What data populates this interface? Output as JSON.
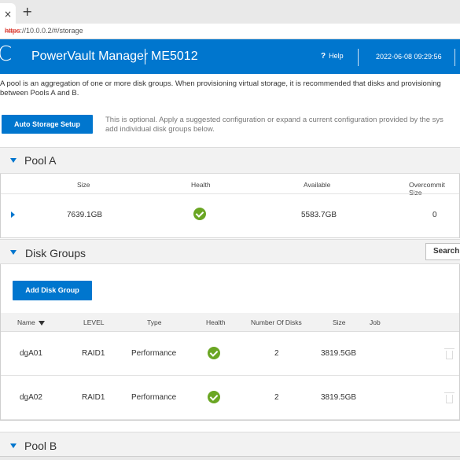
{
  "browser": {
    "tab_close": "×",
    "new_tab": "+",
    "url_protocol": "https",
    "url_rest": "://10.0.0.2/#/storage"
  },
  "header": {
    "logo": "C",
    "app_title": "PowerVault Manager",
    "model": "ME5012",
    "help_icon": "?",
    "help_label": "Help",
    "datetime": "2022-06-08 09:29:56",
    "bg_color": "#0076ce"
  },
  "intro": {
    "line1": "A pool is an aggregation of one or more disk groups. When provisioning virtual storage, it is recommended that disks and provisioning",
    "line2": "between Pools A and B."
  },
  "auto_setup": {
    "button_label": "Auto Storage Setup",
    "note_line1": "This is optional. Apply a suggested configuration or expand a current configuration provided by the sys",
    "note_line2": "add individual disk groups below."
  },
  "pool_a": {
    "title": "Pool A",
    "columns": [
      "Size",
      "Health",
      "Available",
      "Overcommit Size"
    ],
    "row": {
      "size": "7639.1GB",
      "health": "OK",
      "available": "5583.7GB",
      "overcommit": "0"
    }
  },
  "disk_groups": {
    "title": "Disk Groups",
    "search_label": "Search",
    "add_button_label": "Add Disk Group",
    "columns": [
      "Name",
      "LEVEL",
      "Type",
      "Health",
      "Number Of Disks",
      "Size",
      "Job"
    ],
    "rows": [
      {
        "name": "dgA01",
        "level": "RAID1",
        "type": "Performance",
        "health": "OK",
        "disks": "2",
        "size": "3819.5GB",
        "job": ""
      },
      {
        "name": "dgA02",
        "level": "RAID1",
        "type": "Performance",
        "health": "OK",
        "disks": "2",
        "size": "3819.5GB",
        "job": ""
      }
    ]
  },
  "pool_b": {
    "title": "Pool B"
  },
  "colors": {
    "accent": "#0076ce",
    "health_ok": "#6aa623"
  }
}
